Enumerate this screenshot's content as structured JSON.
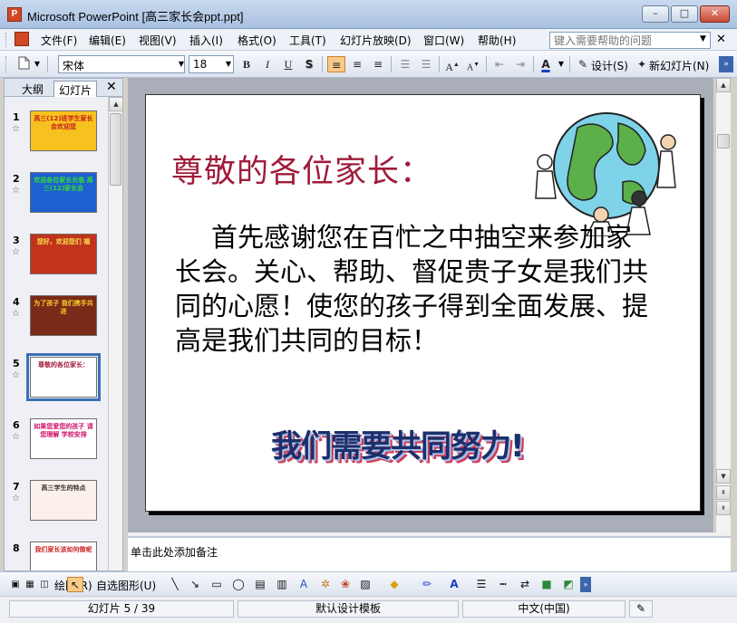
{
  "window": {
    "app_name": "Microsoft PowerPoint",
    "doc_name": "[高三家长会ppt.ppt]",
    "icon_letter": "P"
  },
  "menu": {
    "items": [
      "文件(F)",
      "编辑(E)",
      "视图(V)",
      "插入(I)",
      "格式(O)",
      "工具(T)",
      "幻灯片放映(D)",
      "窗口(W)",
      "帮助(H)"
    ],
    "help_placeholder": "键入需要帮助的问题"
  },
  "toolbar": {
    "font_name": "宋体",
    "font_size": "18",
    "bold": "B",
    "italic": "I",
    "underline": "U",
    "shadow": "S",
    "design_label": "设计(S)",
    "new_slide_label": "新幻灯片(N)"
  },
  "left_panel": {
    "tabs": [
      "大纲",
      "幻灯片"
    ],
    "active_tab": "幻灯片",
    "thumbnails": [
      {
        "num": "1",
        "text": "高三(12)班学生家长会欢迎您",
        "bg": "#f7c21f",
        "color": "#c81e1e"
      },
      {
        "num": "2",
        "text": "欢迎各位家长光临 高三(12)家长会",
        "bg": "#1e5fd2",
        "color": "#33dd33"
      },
      {
        "num": "3",
        "text": "您好，欢迎您们 福",
        "bg": "#c2331e",
        "color": "#f8e04a"
      },
      {
        "num": "4",
        "text": "为了孩子 我们携手共进",
        "bg": "#7a2a18",
        "color": "#f9d02b"
      },
      {
        "num": "5",
        "text": "尊敬的各位家长：",
        "bg": "#ffffff",
        "color": "#a01c3a"
      },
      {
        "num": "6",
        "text": "如果您爱您的孩子 请您理解 学校安排",
        "bg": "#ffffff",
        "color": "#cc1166"
      },
      {
        "num": "7",
        "text": "高三学生的特点",
        "bg": "#fbf1ea",
        "color": "#333333"
      },
      {
        "num": "8",
        "text": "我们家长该如何做呢",
        "bg": "#ffffff",
        "color": "#cc2222"
      }
    ],
    "selected_index": 4
  },
  "slide": {
    "heading": "尊敬的各位家长：",
    "body": "首先感谢您在百忙之中抽空来参加家长会。关心、帮助、督促贵子女是我们共同的心愿！使您的孩子得到全面发展、提高是我们共同的目标！",
    "slogan": "我们需要共同努力!"
  },
  "notes": {
    "placeholder": "单击此处添加备注"
  },
  "drawing": {
    "draw_label": "绘图(R)",
    "autoshape_label": "自选图形(U)"
  },
  "status": {
    "slide_info": "幻灯片 5 / 39",
    "template": "默认设计模板",
    "language": "中文(中国)"
  },
  "colors": {
    "heading": "#a01c3a",
    "slogan": "#1d2f6b",
    "selection": "#3d6fb8",
    "title_bar": "#a9c1e2"
  }
}
